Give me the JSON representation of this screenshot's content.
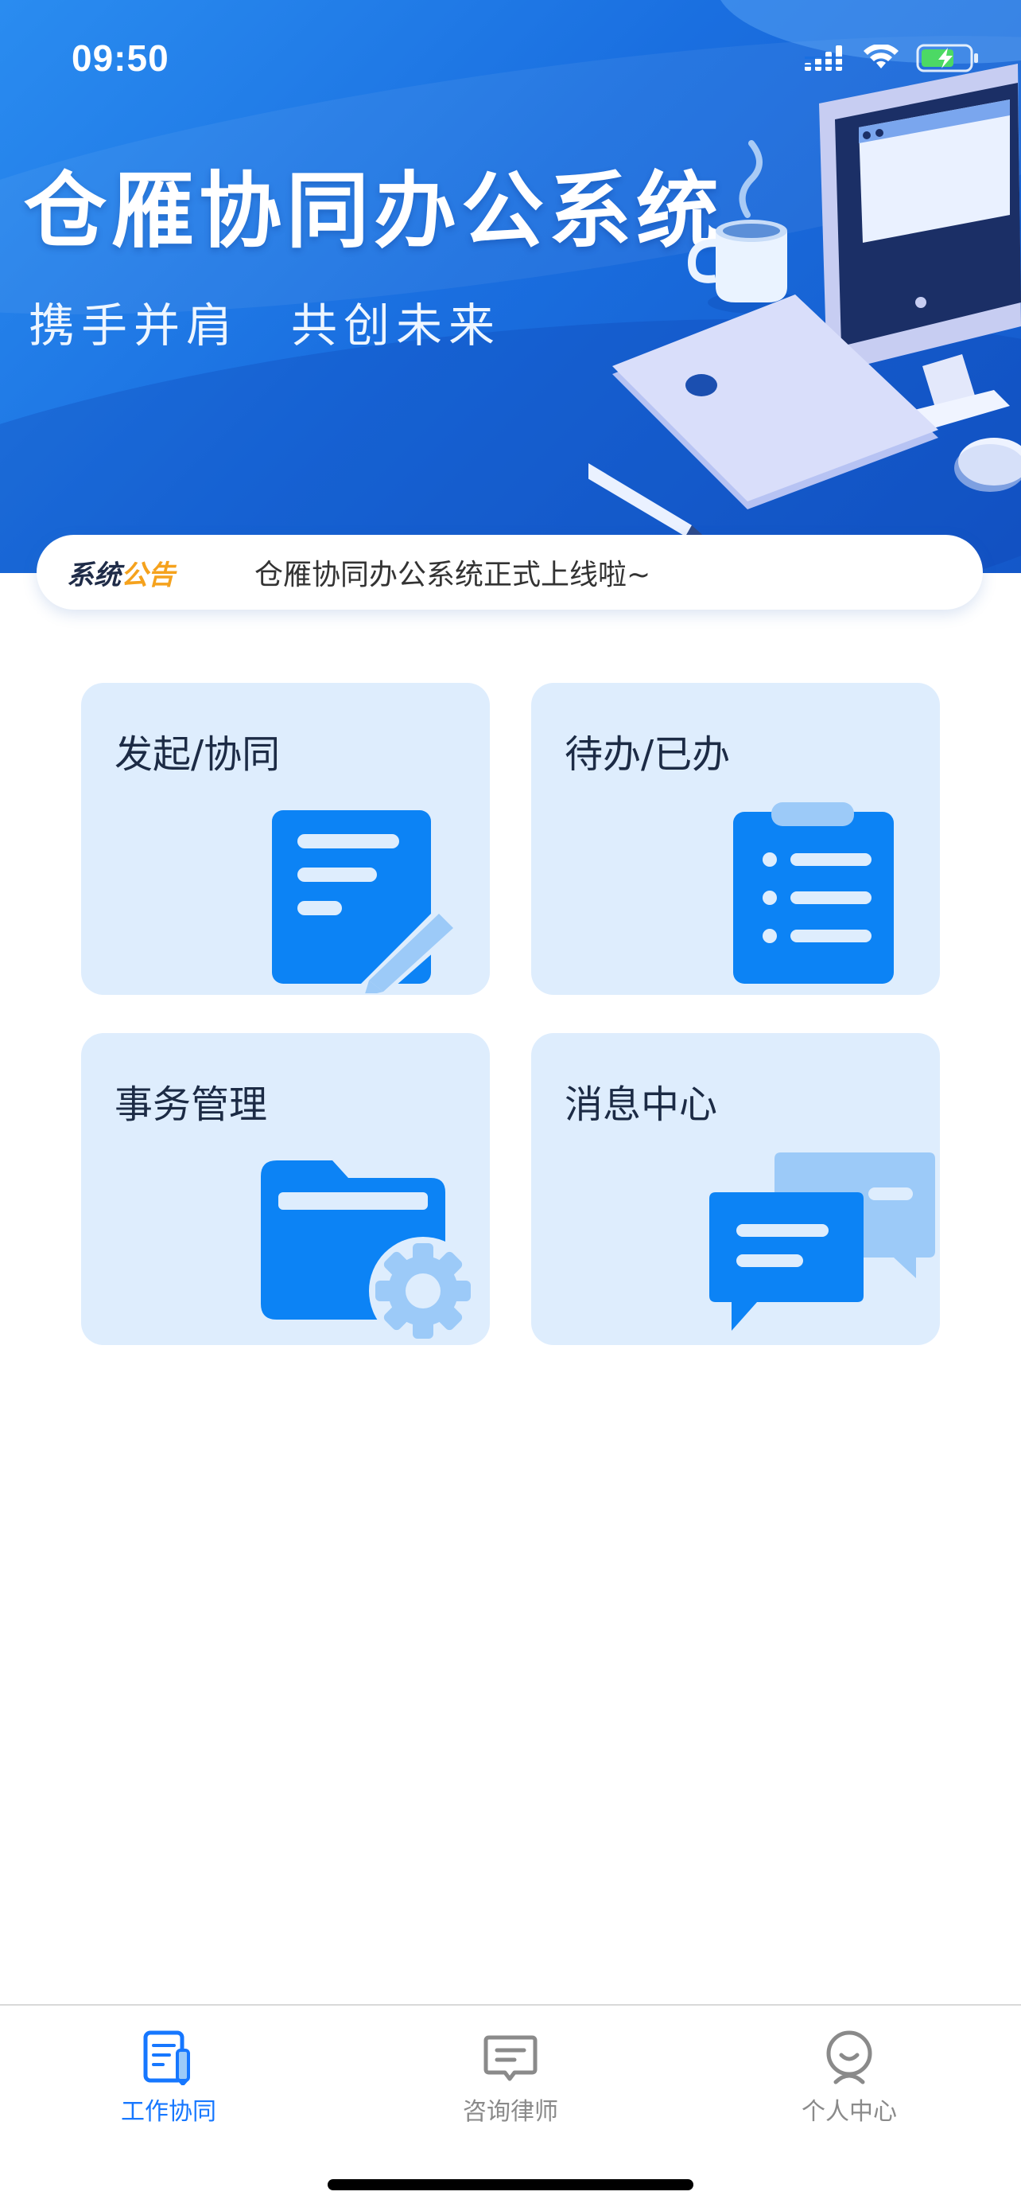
{
  "status_bar": {
    "time": "09:50"
  },
  "hero": {
    "title": "仓雁协同办公系统",
    "subtitle": "携手并肩　共创未来"
  },
  "notice": {
    "tag_part1": "系统",
    "tag_part2": "公告",
    "text": "仓雁协同办公系统正式上线啦~"
  },
  "cards": [
    {
      "label": "发起/协同",
      "icon": "document-edit-icon"
    },
    {
      "label": "待办/已办",
      "icon": "clipboard-list-icon"
    },
    {
      "label": "事务管理",
      "icon": "folder-settings-icon"
    },
    {
      "label": "消息中心",
      "icon": "chat-bubbles-icon"
    }
  ],
  "tabbar": {
    "items": [
      {
        "label": "工作协同",
        "icon": "document-edit-icon",
        "active": true
      },
      {
        "label": "咨询律师",
        "icon": "message-icon",
        "active": false
      },
      {
        "label": "个人中心",
        "icon": "user-icon",
        "active": false
      }
    ]
  },
  "colors": {
    "primary": "#1677ff",
    "card_bg": "#deedfd",
    "notice_accent": "#f5a21d",
    "tab_inactive": "#8a8a8a"
  }
}
